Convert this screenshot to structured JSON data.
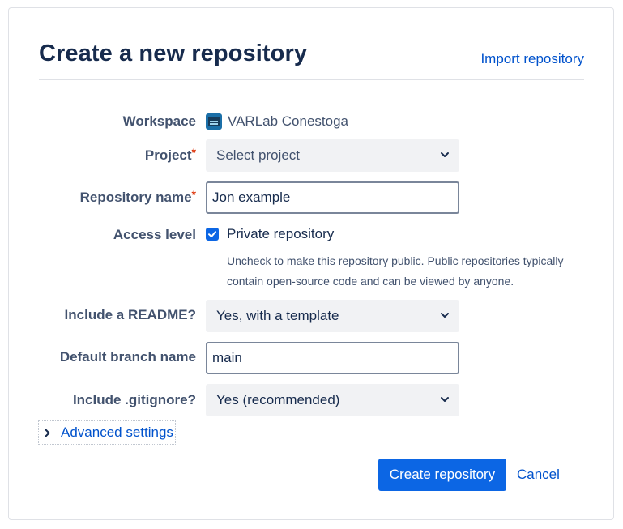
{
  "header": {
    "title": "Create a new repository",
    "import_link": "Import repository"
  },
  "form": {
    "workspace": {
      "label": "Workspace",
      "value": "VARLab Conestoga",
      "icon": "workspace-icon"
    },
    "project": {
      "label": "Project",
      "required_mark": "*",
      "placeholder": "Select project"
    },
    "repository_name": {
      "label": "Repository name",
      "required_mark": "*",
      "value": "Jon example"
    },
    "access_level": {
      "label": "Access level",
      "checkbox_label": "Private repository",
      "checked": true,
      "helper_text": "Uncheck to make this repository public. Public repositories typically contain open-source code and can be viewed by anyone."
    },
    "readme": {
      "label": "Include a README?",
      "selected": "Yes, with a template"
    },
    "default_branch": {
      "label": "Default branch name",
      "value": "main"
    },
    "gitignore": {
      "label": "Include .gitignore?",
      "selected": "Yes (recommended)"
    },
    "advanced_settings": "Advanced settings"
  },
  "actions": {
    "create_label": "Create repository",
    "cancel_label": "Cancel"
  },
  "colors": {
    "primary": "#0c66e4",
    "link": "#0052cc",
    "required": "#de350b",
    "text": "#172b4d",
    "subtle_text": "#42526e",
    "select_bg": "#f1f2f4"
  }
}
